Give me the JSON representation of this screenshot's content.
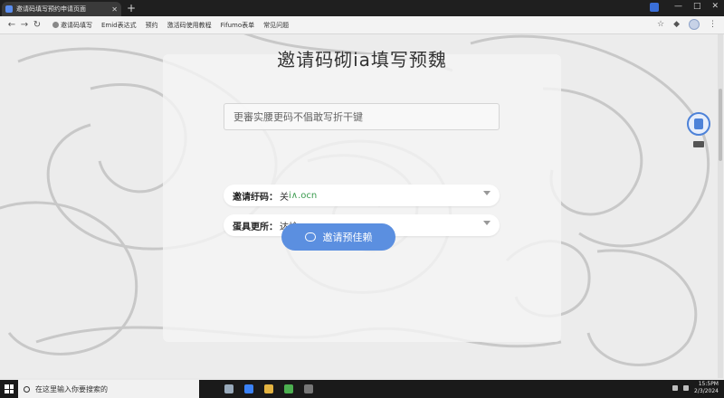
{
  "browser": {
    "tab_title": "邀请码填写预约申请页面",
    "new_tab": "+",
    "bookmarks": [
      "邀请码填写",
      "Emid表达式",
      "预约",
      "激活码使用教程",
      "Fifumo表单",
      "常见问题"
    ],
    "window_controls": [
      "—",
      "□",
      "✕"
    ]
  },
  "form": {
    "title": "邀请码砌ia填写预魏",
    "input_placeholder": "更審实腰更码不倡敢写折干键",
    "select1": {
      "label": "邀请纡码：",
      "value_prefix": "关",
      "value_suffix": "i∧.ocn"
    },
    "select2": {
      "label": "蛋具更所：",
      "value": "达焓"
    },
    "submit_label": "邀请预佳赖"
  },
  "taskbar": {
    "search_placeholder": "在这里输入你要搜索的",
    "time": "15:5PM",
    "date": "2/3/2024"
  },
  "colors": {
    "accent": "#5b8fe0",
    "tab_bg": "#3a3a3a",
    "taskbar": "#1a1a1a"
  }
}
